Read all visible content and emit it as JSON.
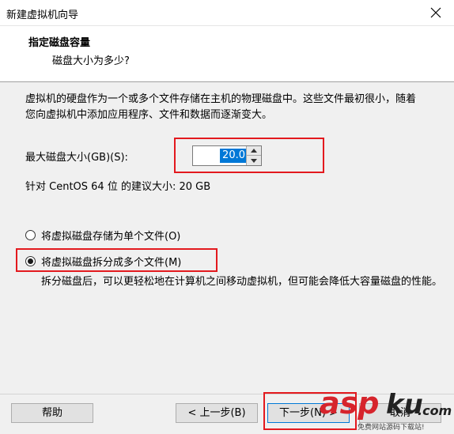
{
  "window": {
    "title": "新建虚拟机向导"
  },
  "header": {
    "title": "指定磁盘容量",
    "subtitle": "磁盘大小为多少?"
  },
  "body": {
    "description": "虚拟机的硬盘作为一个或多个文件存储在主机的物理磁盘中。这些文件最初很小，随着您向虚拟机中添加应用程序、文件和数据而逐渐变大。",
    "size_label": "最大磁盘大小(GB)(S):",
    "size_value": "20.0",
    "recommend": "针对 CentOS 64 位 的建议大小: 20 GB",
    "option_single": "将虚拟磁盘存储为单个文件(O)",
    "option_split": "将虚拟磁盘拆分成多个文件(M)",
    "split_desc": "拆分磁盘后，可以更轻松地在计算机之间移动虚拟机，但可能会降低大容量磁盘的性能。"
  },
  "footer": {
    "help": "帮助",
    "back": "< 上一步(B)",
    "next": "下一步(N) >",
    "cancel": "取消"
  },
  "watermark": {
    "text_a": "asp",
    "text_b": "ku",
    "text_c": ".com",
    "sub": "免费网站源码下载站!"
  },
  "colors": {
    "highlight": "#e3191e",
    "selection": "#0078d7",
    "watermark_a": "#d6242c",
    "watermark_b": "#222222"
  }
}
